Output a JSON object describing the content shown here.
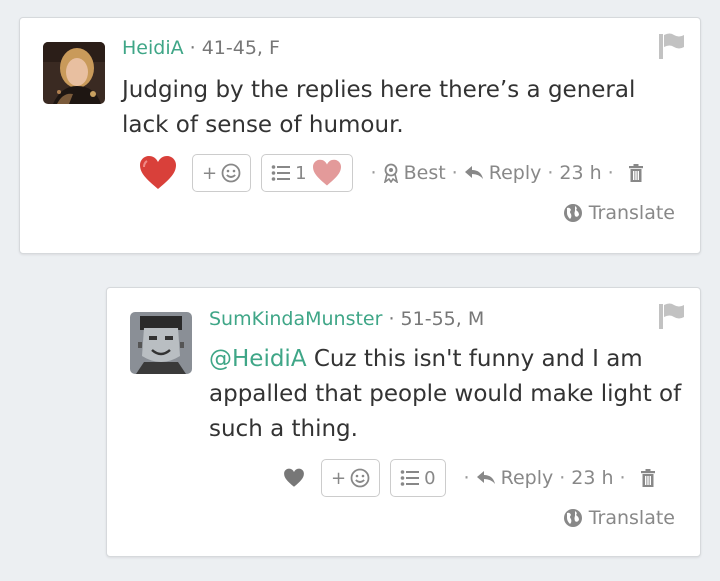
{
  "comments": [
    {
      "username": "HeidiA",
      "demographics": "· 41-45, F",
      "body": "Judging by the replies here there’s a general lack of sense of humour.",
      "mention": "",
      "reactions_count": "1",
      "best_label": "Best",
      "reply_label": "Reply",
      "time": "23 h",
      "translate_label": "Translate",
      "liked": true,
      "avatar_icon": "user-photo-woman"
    },
    {
      "username": "SumKindaMunster",
      "demographics": "· 51-55, M",
      "mention": "@HeidiA",
      "body": " Cuz this isn't funny and I am appalled that people would make light of such a thing.",
      "reactions_count": "0",
      "reply_label": "Reply",
      "time": "23 h",
      "translate_label": "Translate",
      "liked": false,
      "avatar_icon": "user-photo-munster"
    }
  ],
  "add_reaction_label": "+",
  "colors": {
    "accent": "#3fa687",
    "heart_liked": "#d9403a",
    "heart_reaction": "#e39a9a",
    "muted": "#777777",
    "background": "#eceff2"
  },
  "icons": [
    "flag-icon",
    "heart-icon",
    "smiley-icon",
    "list-icon",
    "award-icon",
    "reply-arrow-icon",
    "trash-icon",
    "globe-icon"
  ]
}
